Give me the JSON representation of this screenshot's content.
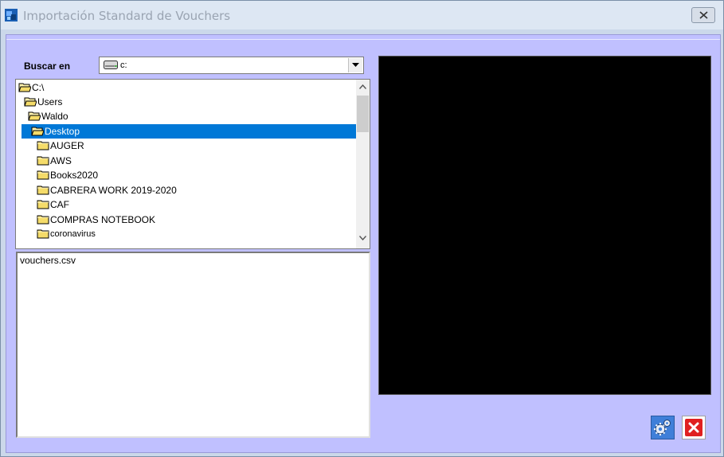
{
  "window": {
    "title": "Importación Standard de Vouchers"
  },
  "look_in": {
    "label": "Buscar en",
    "value": "c:"
  },
  "tree": {
    "items": [
      {
        "label": "C:\\",
        "type": "open-folder",
        "selected": false
      },
      {
        "label": "Users",
        "type": "open-folder",
        "selected": false
      },
      {
        "label": "Waldo",
        "type": "open-folder",
        "selected": false
      },
      {
        "label": "Desktop",
        "type": "open-folder",
        "selected": true
      },
      {
        "label": "AUGER",
        "type": "folder",
        "selected": false
      },
      {
        "label": "AWS",
        "type": "folder",
        "selected": false
      },
      {
        "label": "Books2020",
        "type": "folder",
        "selected": false
      },
      {
        "label": "CABRERA WORK 2019-2020",
        "type": "folder",
        "selected": false
      },
      {
        "label": "CAF",
        "type": "folder",
        "selected": false
      },
      {
        "label": "COMPRAS NOTEBOOK",
        "type": "folder",
        "selected": false
      },
      {
        "label": "coronavirus",
        "type": "folder",
        "selected": false
      }
    ]
  },
  "files": {
    "items": [
      "vouchers.csv"
    ]
  },
  "colors": {
    "client_bg": "#c0c0ff",
    "selection": "#0078d7",
    "preview_bg": "#000000"
  },
  "icons": {
    "app": "app-icon",
    "drive": "drive-icon",
    "folder": "folder-icon",
    "open_folder": "open-folder-icon",
    "process": "gears-icon",
    "exit": "close-icon"
  }
}
